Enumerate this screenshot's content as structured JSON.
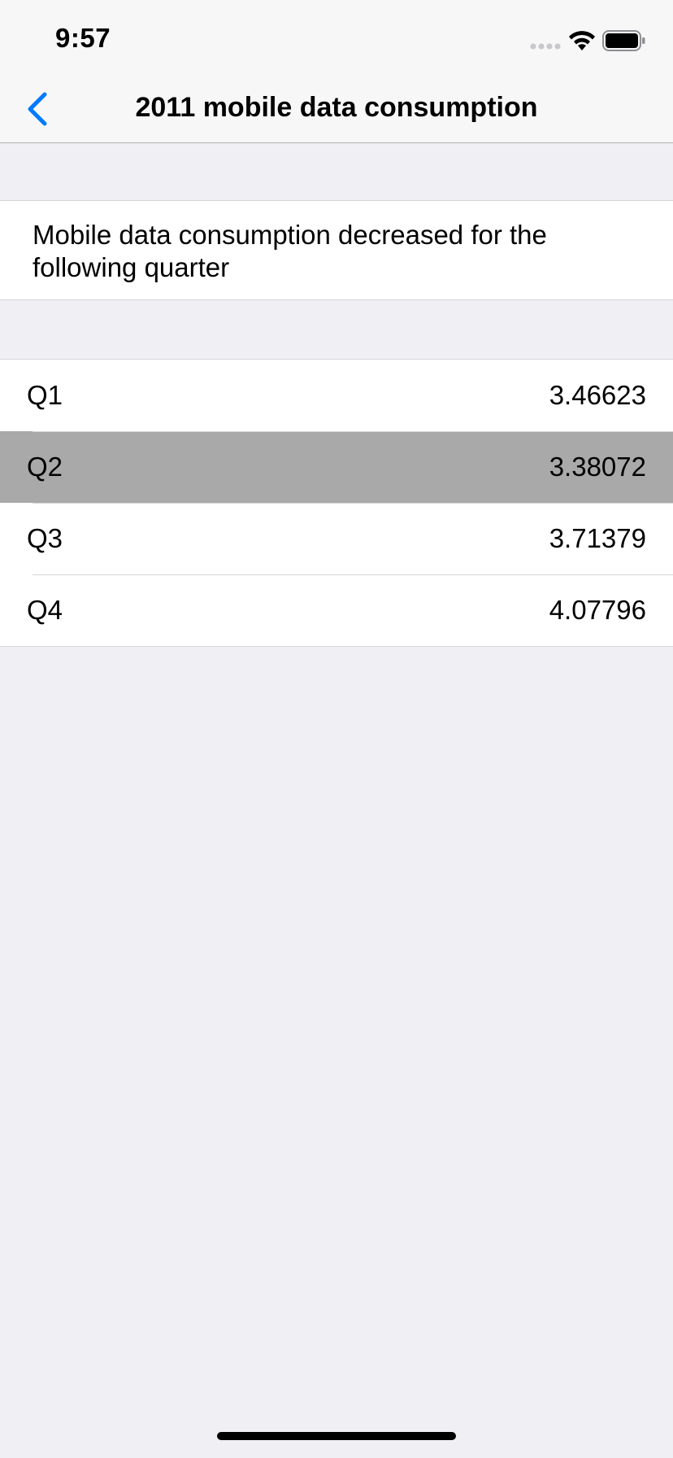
{
  "status_bar": {
    "time": "9:57"
  },
  "nav": {
    "title": "2011 mobile data consumption",
    "back_icon": "chevron-left-icon"
  },
  "message": {
    "text": "Mobile data consumption decreased for the following quarter"
  },
  "table": {
    "rows": [
      {
        "label": "Q1",
        "value": "3.46623",
        "selected": false
      },
      {
        "label": "Q2",
        "value": "3.38072",
        "selected": true
      },
      {
        "label": "Q3",
        "value": "3.71379",
        "selected": false
      },
      {
        "label": "Q4",
        "value": "4.07796",
        "selected": false
      }
    ]
  },
  "colors": {
    "accent": "#007aff",
    "selected_row": "#a9a9a9",
    "background": "#efeff4"
  }
}
